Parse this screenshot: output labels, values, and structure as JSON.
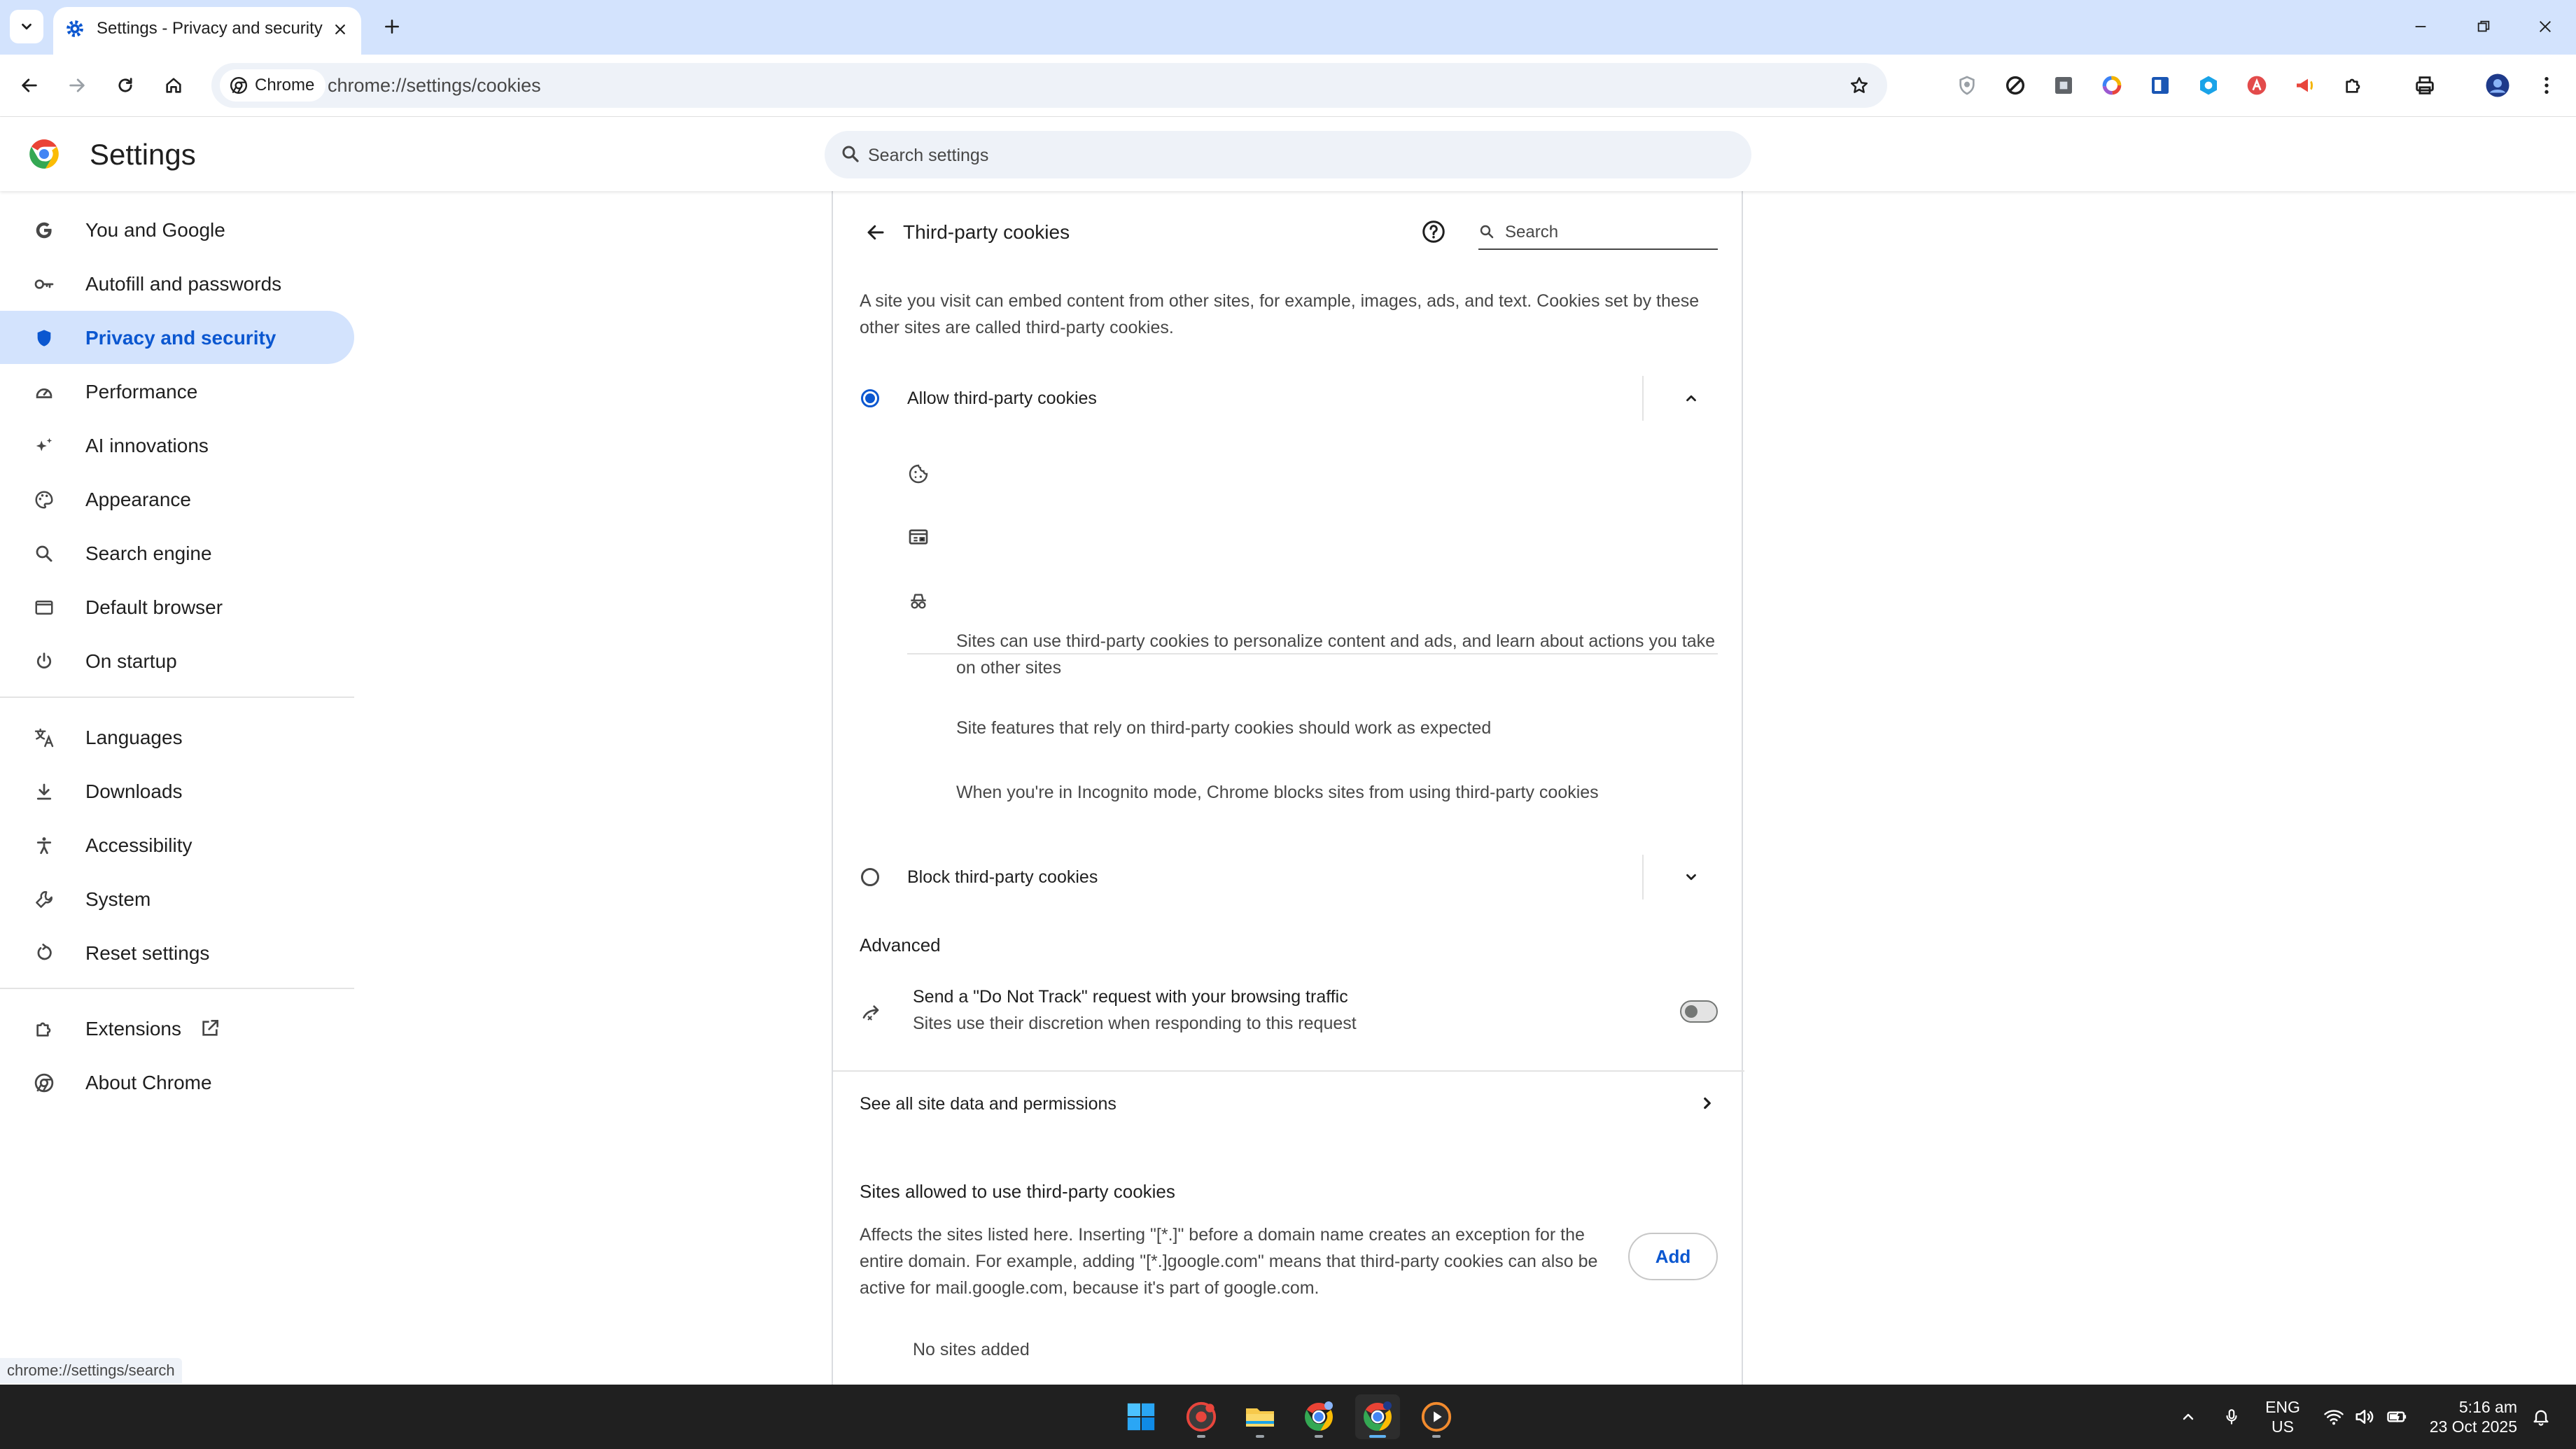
{
  "browser": {
    "tab_title": "Settings - Privacy and security",
    "omnibox_chip": "Chrome",
    "url": "chrome://settings/cookies",
    "status_url": "chrome://settings/search"
  },
  "settings": {
    "title": "Settings",
    "search_placeholder": "Search settings"
  },
  "sidebar": {
    "items": [
      {
        "label": "You and Google",
        "icon": "google-icon"
      },
      {
        "label": "Autofill and passwords",
        "icon": "key-icon"
      },
      {
        "label": "Privacy and security",
        "icon": "shield-icon",
        "selected": true
      },
      {
        "label": "Performance",
        "icon": "speedometer-icon"
      },
      {
        "label": "AI innovations",
        "icon": "sparkle-icon"
      },
      {
        "label": "Appearance",
        "icon": "palette-icon"
      },
      {
        "label": "Search engine",
        "icon": "search-icon"
      },
      {
        "label": "Default browser",
        "icon": "browser-window-icon"
      },
      {
        "label": "On startup",
        "icon": "power-icon"
      },
      {
        "label": "Languages",
        "icon": "translate-icon"
      },
      {
        "label": "Downloads",
        "icon": "download-icon"
      },
      {
        "label": "Accessibility",
        "icon": "accessibility-icon"
      },
      {
        "label": "System",
        "icon": "wrench-icon"
      },
      {
        "label": "Reset settings",
        "icon": "reset-icon"
      },
      {
        "label": "Extensions",
        "icon": "puzzle-icon"
      },
      {
        "label": "About Chrome",
        "icon": "chrome-icon"
      }
    ]
  },
  "page": {
    "title": "Third-party cookies",
    "search_placeholder": "Search",
    "description_line1": "A site you visit can embed content from other sites, for example, images, ads, and text. Cookies set by these",
    "description_line2": "other sites are called third-party cookies.",
    "allow_option": {
      "label": "Allow third-party cookies",
      "selected": true,
      "details": [
        {
          "icon": "cookie-icon",
          "line1": "Sites can use third-party cookies to personalize content and ads, and learn about actions you take",
          "line2": "on other sites"
        },
        {
          "icon": "web-features-icon",
          "line1": "Site features that rely on third-party cookies should work as expected"
        },
        {
          "icon": "incognito-icon",
          "line1": "When you're in Incognito mode, Chrome blocks sites from using third-party cookies"
        }
      ]
    },
    "block_option": {
      "label": "Block third-party cookies",
      "selected": false
    },
    "advanced_heading": "Advanced",
    "do_not_track": {
      "title": "Send a \"Do Not Track\" request with your browsing traffic",
      "subtitle": "Sites use their discretion when responding to this request",
      "enabled": false
    },
    "site_data_link": "See all site data and permissions",
    "allowed_sites": {
      "heading": "Sites allowed to use third-party cookies",
      "desc_line1": "Affects the sites listed here. Inserting \"[*.]\" before a domain name creates an exception for the",
      "desc_line2": "entire domain. For example, adding \"[*.]google.com\" means that third-party cookies can also be",
      "desc_line3": "active for mail.google.com, because it's part of google.com.",
      "add_label": "Add",
      "empty_label": "No sites added"
    }
  },
  "taskbar": {
    "lang_top": "ENG",
    "lang_bottom": "US",
    "time": "5:16 am",
    "date": "23 Oct 2025"
  },
  "colors": {
    "accent": "#0b57d0",
    "selected_nav_bg": "#d3e3fd",
    "tabstrip_bg": "#d3e3fd",
    "taskbar_bg": "#202020"
  }
}
